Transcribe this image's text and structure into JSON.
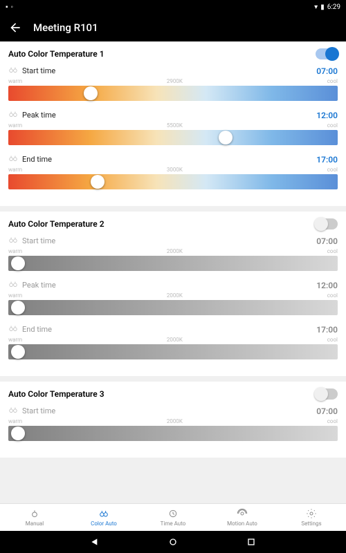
{
  "statusBar": {
    "time": "6:29"
  },
  "appBar": {
    "title": "Meeting R101"
  },
  "labels": {
    "warm": "warm",
    "cool": "cool"
  },
  "sections": [
    {
      "title": "Auto Color Temperature 1",
      "enabled": true,
      "rows": [
        {
          "label": "Start time",
          "time": "07:00",
          "temp": "2900K",
          "pos": 25
        },
        {
          "label": "Peak time",
          "time": "12:00",
          "temp": "5500K",
          "pos": 66
        },
        {
          "label": "End time",
          "time": "17:00",
          "temp": "3000K",
          "pos": 27
        }
      ]
    },
    {
      "title": "Auto Color Temperature 2",
      "enabled": false,
      "rows": [
        {
          "label": "Start time",
          "time": "07:00",
          "temp": "2000K",
          "pos": 3
        },
        {
          "label": "Peak time",
          "time": "12:00",
          "temp": "2000K",
          "pos": 3
        },
        {
          "label": "End time",
          "time": "17:00",
          "temp": "2000K",
          "pos": 3
        }
      ]
    },
    {
      "title": "Auto Color Temperature 3",
      "enabled": false,
      "rows": [
        {
          "label": "Start time",
          "time": "07:00",
          "temp": "2000K",
          "pos": 3
        }
      ]
    }
  ],
  "nav": [
    {
      "label": "Manual",
      "active": false
    },
    {
      "label": "Color Auto",
      "active": true
    },
    {
      "label": "Time Auto",
      "active": false
    },
    {
      "label": "Motion Auto",
      "active": false
    },
    {
      "label": "Settings",
      "active": false
    }
  ]
}
